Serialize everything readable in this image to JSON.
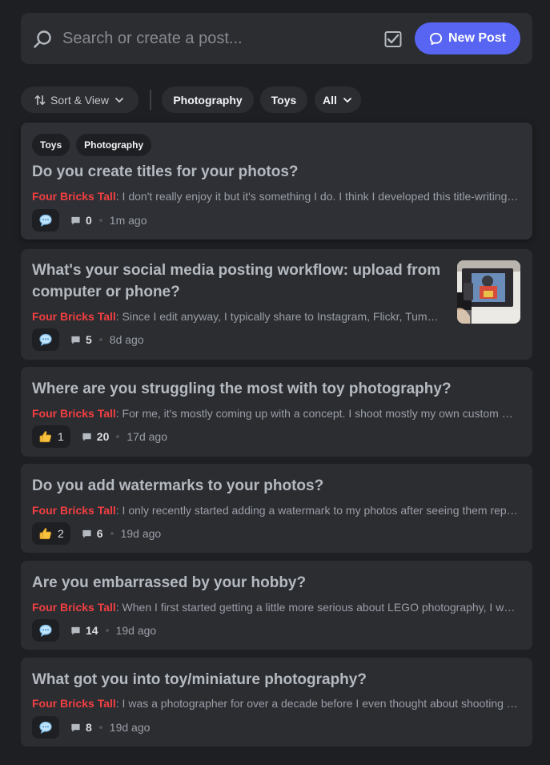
{
  "search": {
    "placeholder": "Search or create a post..."
  },
  "toolbar": {
    "new_post_label": "New Post"
  },
  "filters": {
    "sort_label": "Sort & View",
    "tags": [
      "Photography",
      "Toys"
    ],
    "all_label": "All"
  },
  "posts": [
    {
      "tags": [
        "Toys",
        "Photography"
      ],
      "title": "Do you create titles for your photos?",
      "author": "Four Bricks Tall",
      "preview": ": I don't really enjoy it but it's something I do. I think I developed this title-writing habit after years of sharing on Flickr.",
      "reaction_icon": "speech-bubble-icon",
      "reaction_count": "",
      "replies": "0",
      "time": "1m ago"
    },
    {
      "tags": [],
      "title": "What's your social media posting workflow: upload from computer or phone?",
      "author": "Four Bricks Tall",
      "preview": ": Since I edit anyway, I typically share to Instagram, Flickr, Tumblr and more from my computer.",
      "reaction_icon": "speech-bubble-icon",
      "reaction_count": "",
      "replies": "5",
      "time": "8d ago",
      "thumbnail_icon": "photo-thumbnail"
    },
    {
      "tags": [],
      "title": "Where are you struggling the most with toy photography?",
      "author": "Four Bricks Tall",
      "preview": ": For me, it's mostly coming up with a concept. I shoot mostly my own custom minifigures.",
      "reaction_icon": "thumbs-up-icon",
      "reaction_count": "1",
      "replies": "20",
      "time": "17d ago"
    },
    {
      "tags": [],
      "title": "Do you add watermarks to your photos?",
      "author": "Four Bricks Tall",
      "preview": ": I only recently started adding a watermark to my photos after seeing them reposted.",
      "reaction_icon": "thumbs-up-icon",
      "reaction_count": "2",
      "replies": "6",
      "time": "19d ago"
    },
    {
      "tags": [],
      "title": "Are you embarrassed by your hobby?",
      "author": "Four Bricks Tall",
      "preview": ": When I first started getting a little more serious about LEGO photography, I was hesitant to tell people.",
      "reaction_icon": "speech-bubble-icon",
      "reaction_count": "",
      "replies": "14",
      "time": "19d ago"
    },
    {
      "tags": [],
      "title": "What got you into toy/miniature photography?",
      "author": "Four Bricks Tall",
      "preview": ": I was a photographer for over a decade before I even thought about shooting toys.",
      "reaction_icon": "speech-bubble-icon",
      "reaction_count": "",
      "replies": "8",
      "time": "19d ago"
    }
  ],
  "colors": {
    "accent": "#5865f2",
    "author": "#f23f42",
    "background": "#1e1f22",
    "card": "#2b2d31"
  }
}
